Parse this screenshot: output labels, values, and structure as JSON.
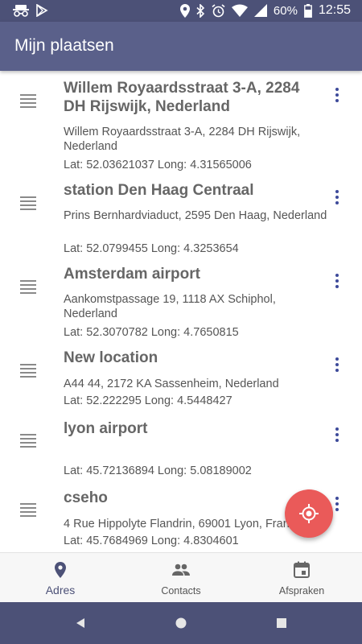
{
  "status_bar": {
    "battery": "60%",
    "time": "12:55",
    "icons": [
      "incognito-icon",
      "play-store-icon",
      "location-icon",
      "bluetooth-icon",
      "alarm-icon",
      "wifi-icon",
      "signal-icon",
      "battery-icon"
    ]
  },
  "app_bar": {
    "title": "Mijn plaatsen"
  },
  "places": [
    {
      "title": "Willem Royaardsstraat 3-A, 2284 DH Rijswijk, Nederland",
      "address": "Willem Royaardsstraat 3-A, 2284 DH Rijswijk, Nederland",
      "coords": "Lat: 52.03621037 Long: 4.31565006"
    },
    {
      "title": "station Den Haag Centraal",
      "address": "Prins Bernhardviaduct, 2595 Den Haag, Nederland",
      "coords": "Lat: 52.0799455 Long: 4.3253654"
    },
    {
      "title": "Amsterdam airport",
      "address": "Aankomstpassage 19, 1118 AX Schiphol, Nederland",
      "coords": "Lat: 52.3070782 Long: 4.7650815"
    },
    {
      "title": "New location",
      "address": "A44 44, 2172 KA Sassenheim, Nederland",
      "coords": "Lat: 52.222295 Long: 4.5448427"
    },
    {
      "title": "lyon airport",
      "address": "",
      "coords": "Lat: 45.72136894 Long: 5.08189002"
    },
    {
      "title": "cseho",
      "address": "4 Rue Hippolyte Flandrin, 69001 Lyon, Frankrijk",
      "coords": "Lat: 45.7684969 Long: 4.8304601"
    }
  ],
  "fab": {
    "icon": "gps-locate-icon",
    "color": "#ea5a59"
  },
  "bottom_nav": {
    "items": [
      {
        "label": "Adres",
        "icon": "location-pin-icon",
        "active": true
      },
      {
        "label": "Contacts",
        "icon": "people-icon",
        "active": false
      },
      {
        "label": "Afspraken",
        "icon": "calendar-icon",
        "active": false
      }
    ]
  },
  "colors": {
    "primary": "#5a608a",
    "primary_dark": "#4c5177",
    "accent": "#3d4a9a"
  }
}
